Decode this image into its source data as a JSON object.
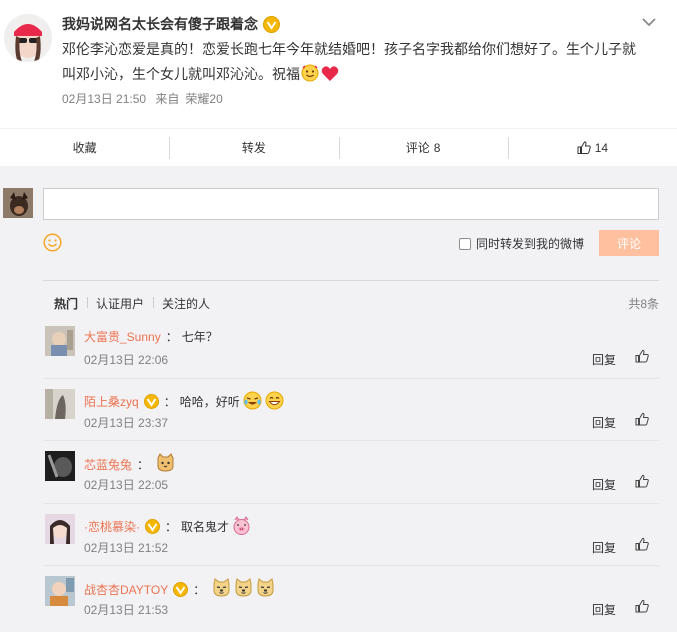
{
  "post": {
    "author": "我妈说网名太长会有傻子跟着念",
    "text_line1": "邓伦李沁恋爱是真的！恋爱长跑七年今年就结婚吧！孩子名字我都给你们想好了。生个儿子就",
    "text_line2": "叫邓小沁，生个女儿就叫邓沁沁。祝福",
    "date": "02月13日 21:50",
    "source_prefix": "来自",
    "source": "荣耀20"
  },
  "actions": {
    "favorite": "收藏",
    "repost": "转发",
    "comment_label": "评论",
    "comment_count": "8",
    "like_count": "14"
  },
  "composer": {
    "placeholder": "",
    "forward_label": "同时转发到我的微博",
    "submit_label": "评论"
  },
  "comment_list": {
    "tabs": [
      "热门",
      "认证用户",
      "关注的人"
    ],
    "total": "共8条",
    "reply_label": "回复",
    "items": [
      {
        "name": "大富贵_Sunny",
        "verified": false,
        "text": "七年？",
        "emojis": [],
        "time": "02月13日 22:06"
      },
      {
        "name": "陌上桑zyq",
        "verified": true,
        "text": "哈哈，好听",
        "emojis": [
          "laugh-cry-emoji",
          "grin-emoji"
        ],
        "time": "02月13日 23:37"
      },
      {
        "name": "芯蓝兔兔",
        "verified": false,
        "text": "",
        "emojis": [
          "cat-emoji"
        ],
        "time": "02月13日 22:05"
      },
      {
        "name": "·恋桃慕染·",
        "verified": true,
        "text": "取名鬼才",
        "emojis": [
          "pig-emoji"
        ],
        "time": "02月13日 21:52"
      },
      {
        "name": "战杏杏DAYTOY",
        "verified": true,
        "text": "",
        "emojis": [
          "doge-emoji",
          "doge-emoji",
          "doge-emoji"
        ],
        "time": "02月13日 21:53"
      }
    ]
  },
  "colors": {
    "name_link": "#eb7350",
    "muted": "#808080",
    "verified_badge": "#f5b700",
    "submit_disabled": "#ffc09f",
    "comment_bg": "#f2f2f5"
  }
}
